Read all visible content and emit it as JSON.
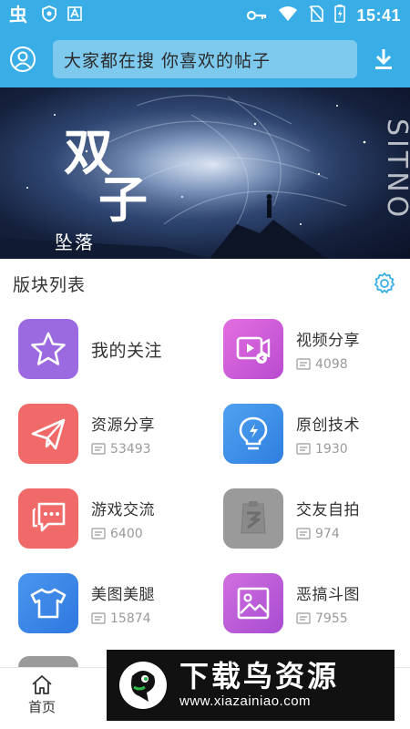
{
  "status_bar": {
    "time": "15:41",
    "left_icons": [
      "app-icon",
      "shield-icon",
      "font-icon"
    ],
    "right_icons": [
      "key-icon",
      "wifi-icon",
      "no-sim-icon",
      "battery-charging-icon"
    ]
  },
  "app_bar": {
    "search_placeholder": "大家都在搜  你喜欢的帖子",
    "color": "#39aee6"
  },
  "banner": {
    "title_line1": "双",
    "title_line2": "子",
    "subtitle": "坠落",
    "side_text": "SITNO",
    "slides": 2,
    "active_slide": 1
  },
  "section": {
    "title": "版块列表"
  },
  "forums": [
    {
      "name": "我的关注",
      "count": "",
      "icon": "star-icon",
      "color": "#9c6ae0"
    },
    {
      "name": "视频分享",
      "count": "4098",
      "icon": "video-share-icon",
      "color": "#d35bd8"
    },
    {
      "name": "资源分享",
      "count": "53493",
      "icon": "paper-plane-icon",
      "color": "#f06a6a"
    },
    {
      "name": "原创技术",
      "count": "1930",
      "icon": "lightbulb-icon",
      "color": "#3f8fe8"
    },
    {
      "name": "游戏交流",
      "count": "6400",
      "icon": "chat-icon",
      "color": "#f06a6a"
    },
    {
      "name": "交友自拍",
      "count": "974",
      "icon": "placeholder-avatar-icon",
      "color": "#9a9a9a"
    },
    {
      "name": "美图美腿",
      "count": "15874",
      "icon": "tshirt-icon",
      "color": "#3b86e8"
    },
    {
      "name": "恶搞斗图",
      "count": "7955",
      "icon": "picture-icon",
      "color": "#c060d8"
    }
  ],
  "bottom_nav": {
    "home_label": "首页"
  },
  "watermark": {
    "title": "下载鸟资源",
    "url": "www.xiazainiao.com"
  }
}
